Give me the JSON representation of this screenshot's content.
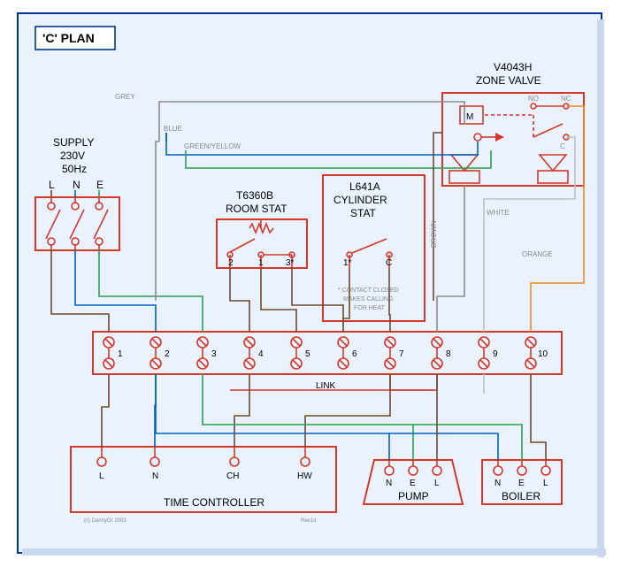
{
  "title": "'C' PLAN",
  "supply": {
    "label": "SUPPLY",
    "voltage": "230V",
    "freq": "50Hz",
    "terms": [
      "L",
      "N",
      "E"
    ]
  },
  "roomstat": {
    "label1": "T6360B",
    "label2": "ROOM STAT",
    "terms": [
      "2",
      "1",
      "3*"
    ]
  },
  "cylstat": {
    "label1": "L641A",
    "label2": "CYLINDER",
    "label3": "STAT",
    "terms": [
      "1*",
      "C"
    ],
    "note1": "* CONTACT CLOSED",
    "note2": "MAKES CALLING",
    "note3": "FOR HEAT"
  },
  "zonevalve": {
    "label1": "V4043H",
    "label2": "ZONE VALVE",
    "labels": {
      "m": "M",
      "no": "NO",
      "nc": "NC",
      "c": "C",
      "arrow": "⊸"
    }
  },
  "wiringcentre": {
    "terms": [
      "1",
      "2",
      "3",
      "4",
      "5",
      "6",
      "7",
      "8",
      "9",
      "10"
    ],
    "link": "LINK"
  },
  "timecontroller": {
    "label": "TIME CONTROLLER",
    "terms": [
      "L",
      "N",
      "CH",
      "HW"
    ]
  },
  "pump": {
    "label": "PUMP",
    "terms": [
      "N",
      "E",
      "L"
    ]
  },
  "boiler": {
    "label": "BOILER",
    "terms": [
      "N",
      "E",
      "L"
    ]
  },
  "wirecolours": {
    "grey": "GREY",
    "blue": "BLUE",
    "greenyellow": "GREEN/YELLOW",
    "brown": "BROWN",
    "white": "WHITE",
    "orange": "ORANGE"
  },
  "credits": {
    "left": "(c) DannyGr 2003",
    "right": "Rev1d"
  }
}
